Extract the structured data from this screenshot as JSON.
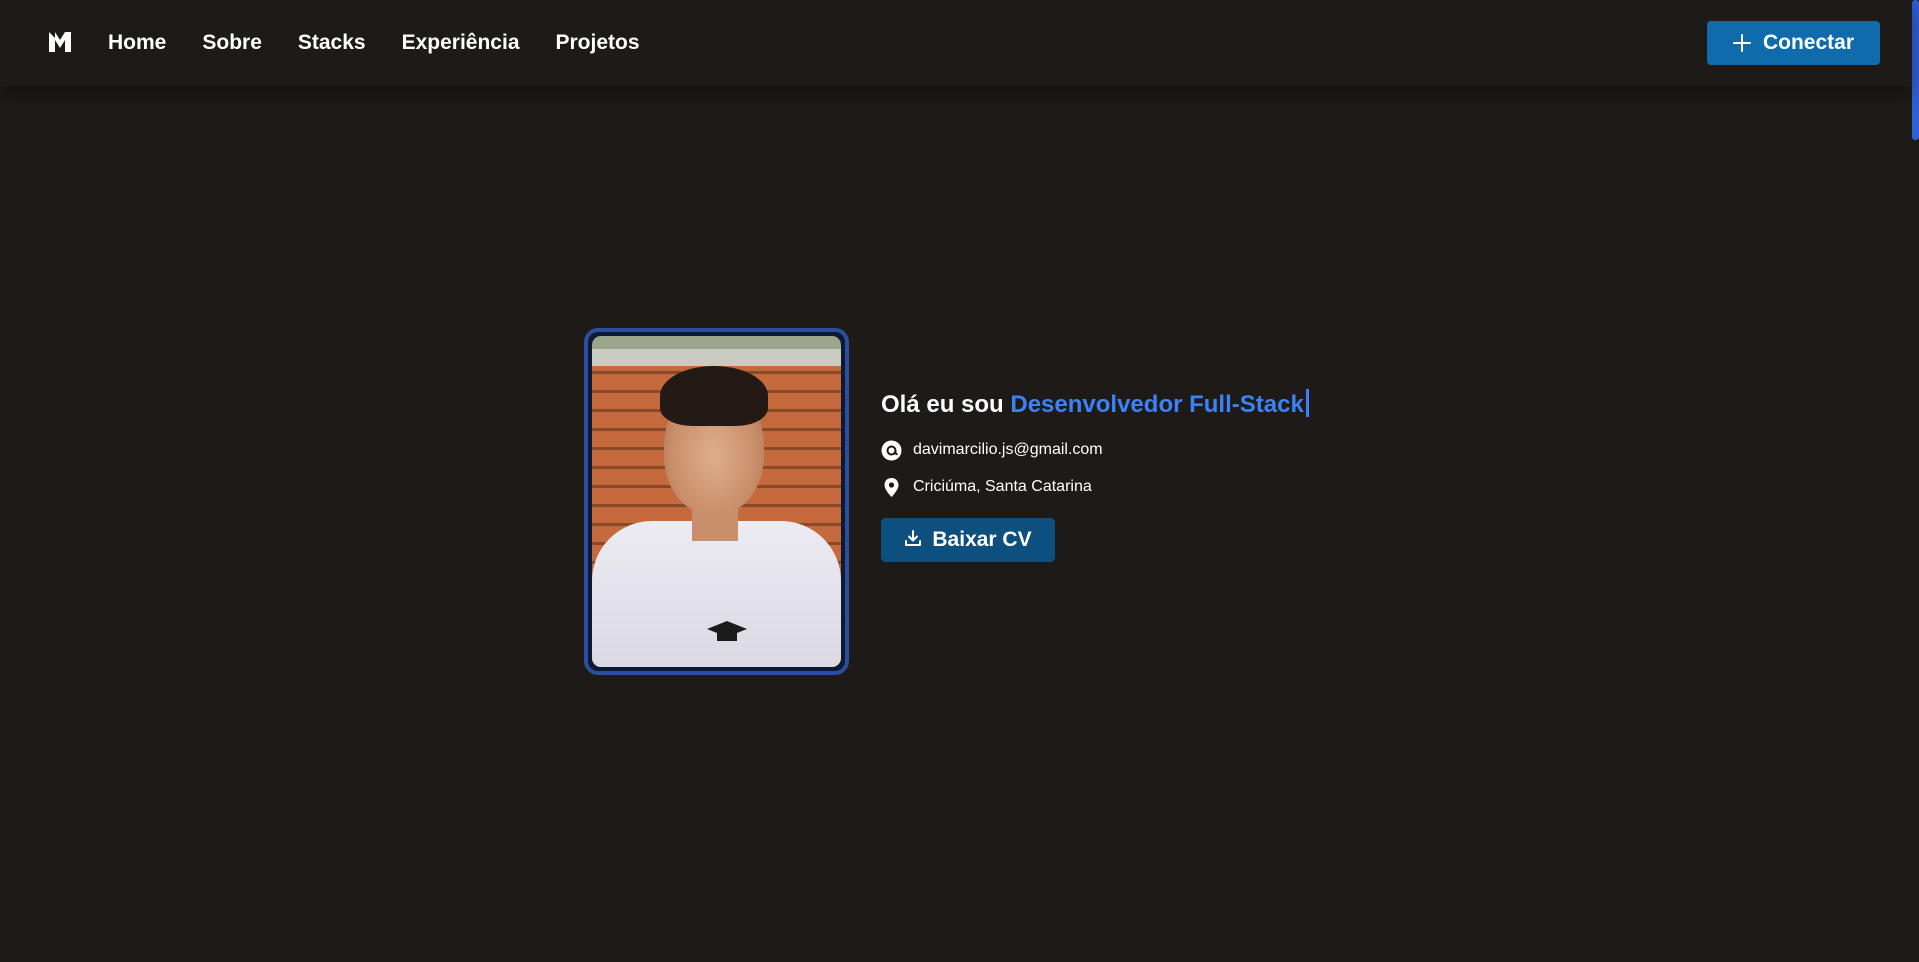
{
  "header": {
    "logo_icon": "dm-monogram-logo-icon",
    "nav": [
      {
        "label": "Home"
      },
      {
        "label": "Sobre"
      },
      {
        "label": "Stacks"
      },
      {
        "label": "Experiência"
      },
      {
        "label": "Projetos"
      }
    ],
    "connect_button": {
      "label": "Conectar",
      "icon": "plus-icon",
      "color": "#0f6bab"
    }
  },
  "hero": {
    "photo_alt": "profile-photo",
    "greeting_prefix": "Olá eu sou",
    "greeting_role": "Desenvolvedor Full-Stack",
    "role_color": "#3b82f6",
    "email": {
      "icon": "at-sign-icon",
      "text": "davimarcilio.js@gmail.com"
    },
    "location": {
      "icon": "map-pin-icon",
      "text": "Criciúma, Santa Catarina"
    },
    "cv_button": {
      "label": "Baixar CV",
      "icon": "download-icon",
      "color": "#0d4f7e"
    }
  },
  "colors": {
    "background": "#1d1a18",
    "accent": "#3b82f6",
    "frame": "#2b4f9e"
  }
}
